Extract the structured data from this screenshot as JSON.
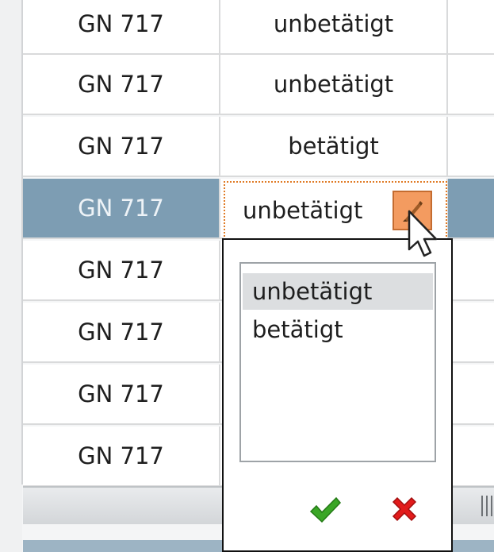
{
  "table": {
    "rows": [
      {
        "name": "GN 717",
        "state": "unbetätigt"
      },
      {
        "name": "GN 717",
        "state": "unbetätigt"
      },
      {
        "name": "GN 717",
        "state": "betätigt"
      },
      {
        "name": "GN 717",
        "state": "unbetätigt"
      },
      {
        "name": "GN 717",
        "state": ""
      },
      {
        "name": "GN 717",
        "state": ""
      },
      {
        "name": "GN 717",
        "state": ""
      },
      {
        "name": "GN 717",
        "state": ""
      }
    ],
    "selected_row_index": 3
  },
  "editor": {
    "value": "unbetätigt",
    "button_icon": "edit-pencil-icon",
    "border_color": "#e07b26",
    "button_color": "#f39b60"
  },
  "dropdown": {
    "options": [
      "unbetätigt",
      "betätigt"
    ],
    "selected_index": 0,
    "confirm_icon": "checkmark-icon",
    "cancel_icon": "close-x-icon"
  },
  "colors": {
    "selection": "#7d9db3",
    "confirm": "#3aa626",
    "cancel": "#e21b1b"
  }
}
